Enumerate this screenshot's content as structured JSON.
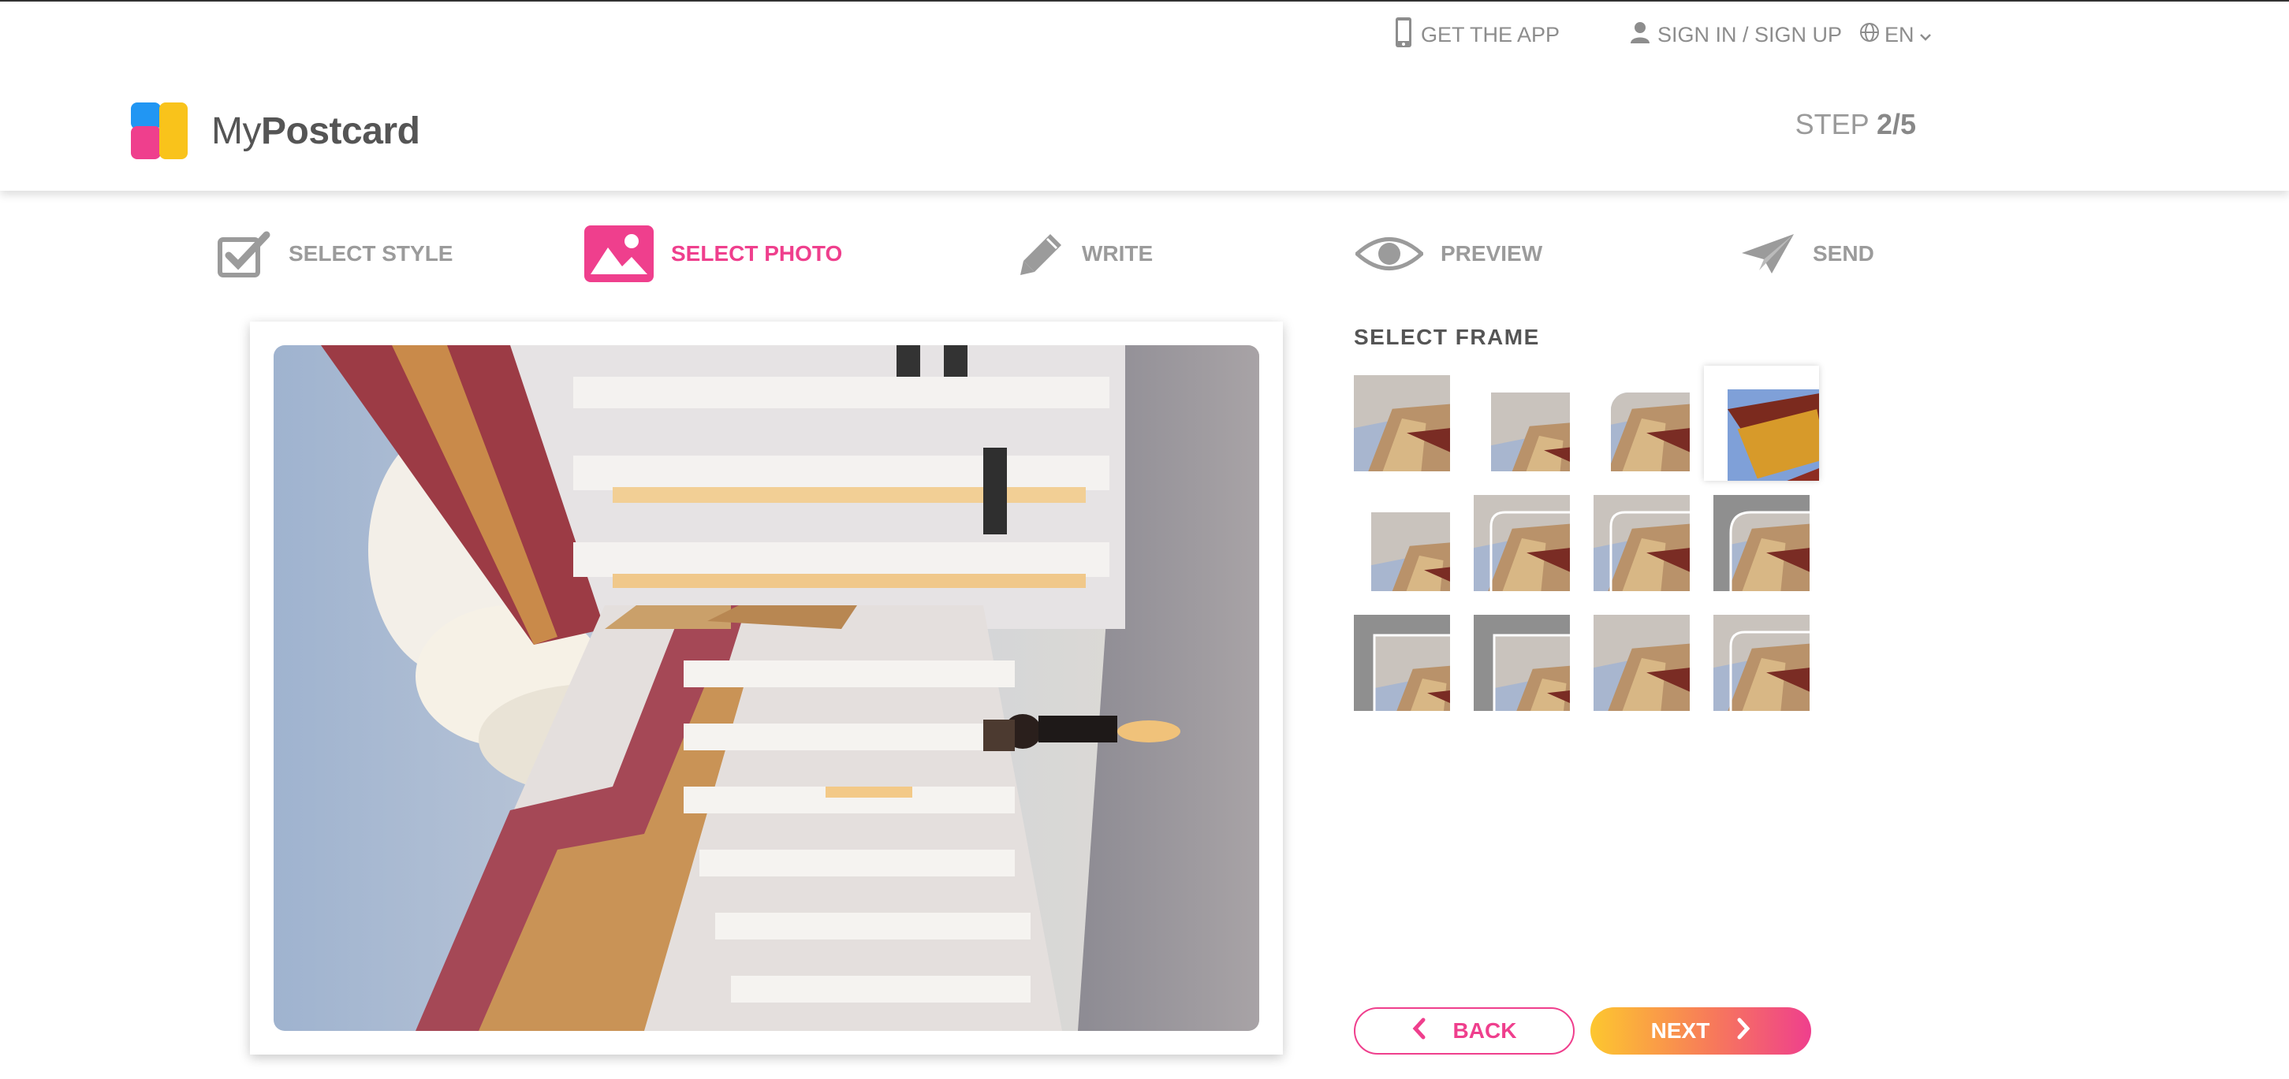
{
  "topbar": {
    "get_app": "GET THE APP",
    "sign_in": "SIGN IN / SIGN UP",
    "language": "EN"
  },
  "brand": {
    "name_light": "My",
    "name_bold": "Postcard",
    "colors": {
      "blue": "#2196f3",
      "pink": "#ef3f8d",
      "yellow": "#f9c31b"
    }
  },
  "progress": {
    "label": "STEP",
    "current": "2/5",
    "value": 0.4
  },
  "steps": [
    {
      "label": "SELECT STYLE",
      "icon": "checkbox-icon",
      "active": false
    },
    {
      "label": "SELECT PHOTO",
      "icon": "image-icon",
      "active": true
    },
    {
      "label": "WRITE",
      "icon": "pencil-icon",
      "active": false
    },
    {
      "label": "PREVIEW",
      "icon": "eye-icon",
      "active": false
    },
    {
      "label": "SEND",
      "icon": "paper-plane-icon",
      "active": false
    }
  ],
  "frames": {
    "title": "SELECT FRAME",
    "selected_index": 3,
    "count": 12
  },
  "buttons": {
    "back": "BACK",
    "next": "NEXT"
  },
  "accent_color": "#ef3f8d"
}
